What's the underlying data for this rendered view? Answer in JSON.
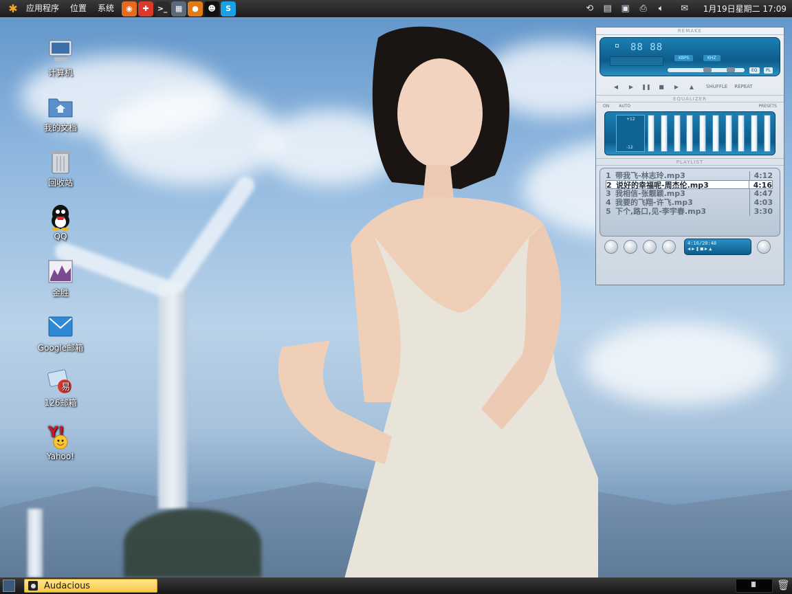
{
  "top_panel": {
    "menus": [
      "应用程序",
      "位置",
      "系统"
    ],
    "launchers": [
      {
        "name": "firefox-icon",
        "color": "#e66a1e"
      },
      {
        "name": "help-icon",
        "color": "#d93a2b"
      },
      {
        "name": "terminal-icon",
        "color": "#2b2b2b"
      },
      {
        "name": "monitor-icon",
        "color": "#5a6a7a"
      },
      {
        "name": "basketball-icon",
        "color": "#e07b17"
      },
      {
        "name": "qq-icon",
        "color": "#111111"
      },
      {
        "name": "skype-icon",
        "color": "#1aa0e6"
      }
    ],
    "clock": "1月19日星期二 17:09"
  },
  "desktop_icons": [
    {
      "label": "计算机",
      "icon": "computer-icon"
    },
    {
      "label": "我的文档",
      "icon": "folder-icon"
    },
    {
      "label": "回收站",
      "icon": "trash-icon"
    },
    {
      "label": "QQ",
      "icon": "qq-penguin-icon"
    },
    {
      "label": "金胜",
      "icon": "stock-chart-icon"
    },
    {
      "label": "Google邮箱",
      "icon": "mail-icon"
    },
    {
      "label": "126邮箱",
      "icon": "mail-126-icon"
    },
    {
      "label": "Yahoo!",
      "icon": "yahoo-icon"
    }
  ],
  "player": {
    "main_title": "REMAKE",
    "time_display": "88 88",
    "kbps_label": "KBPS",
    "khz_label": "KHZ",
    "eq_button": "EQ",
    "pl_button": "PL",
    "shuffle_label": "SHUFFLE",
    "repeat_label": "REPEAT",
    "equalizer_title": "EQUALIZER",
    "eq_on": "ON",
    "eq_auto": "AUTO",
    "eq_presets": "PRESETS",
    "eq_plus": "+12",
    "eq_minus": "-12",
    "playlist_title": "PLAYLIST",
    "playlist": [
      {
        "num": "1",
        "title": "带我飞-林志玲.mp3",
        "time": "4:12"
      },
      {
        "num": "2",
        "title": "说好的幸福呢-周杰伦.mp3",
        "time": "4:16"
      },
      {
        "num": "3",
        "title": "我相信-张靓颖.mp3",
        "time": "4:47"
      },
      {
        "num": "4",
        "title": "我要的飞翔-许飞.mp3",
        "time": "4:03"
      },
      {
        "num": "5",
        "title": "下个,路口,见-李宇春.mp3",
        "time": "3:30"
      }
    ],
    "current_index": 1,
    "playlist_info": "4:16/20:48"
  },
  "taskbar": {
    "task_label": "Audacious"
  },
  "colors": {
    "accent_blue": "#0c5c8b",
    "task_yellow": "#f7c948"
  }
}
